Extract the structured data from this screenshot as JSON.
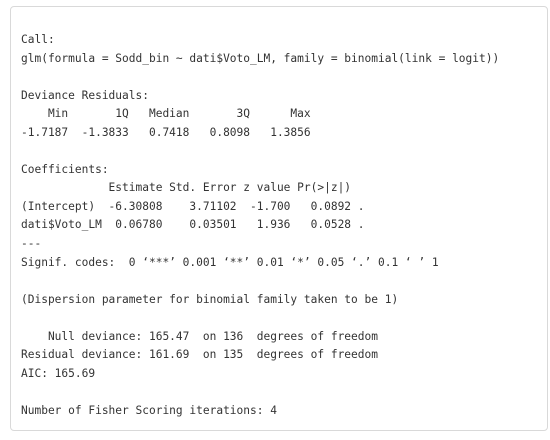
{
  "console": {
    "lines": [
      "Call:",
      "glm(formula = Sodd_bin ~ dati$Voto_LM, family = binomial(link = logit))",
      "",
      "Deviance Residuals:",
      "    Min       1Q   Median       3Q      Max",
      "-1.7187  -1.3833   0.7418   0.8098   1.3856",
      "",
      "Coefficients:",
      "             Estimate Std. Error z value Pr(>|z|)",
      "(Intercept)  -6.30808    3.71102  -1.700   0.0892 .",
      "dati$Voto_LM  0.06780    0.03501   1.936   0.0528 .",
      "---",
      "Signif. codes:  0 ‘***’ 0.001 ‘**’ 0.01 ‘*’ 0.05 ‘.’ 0.1 ‘ ’ 1",
      "",
      "(Dispersion parameter for binomial family taken to be 1)",
      "",
      "    Null deviance: 165.47  on 136  degrees of freedom",
      "Residual deviance: 161.69  on 135  degrees of freedom",
      "AIC: 165.69",
      "",
      "Number of Fisher Scoring iterations: 4"
    ]
  }
}
